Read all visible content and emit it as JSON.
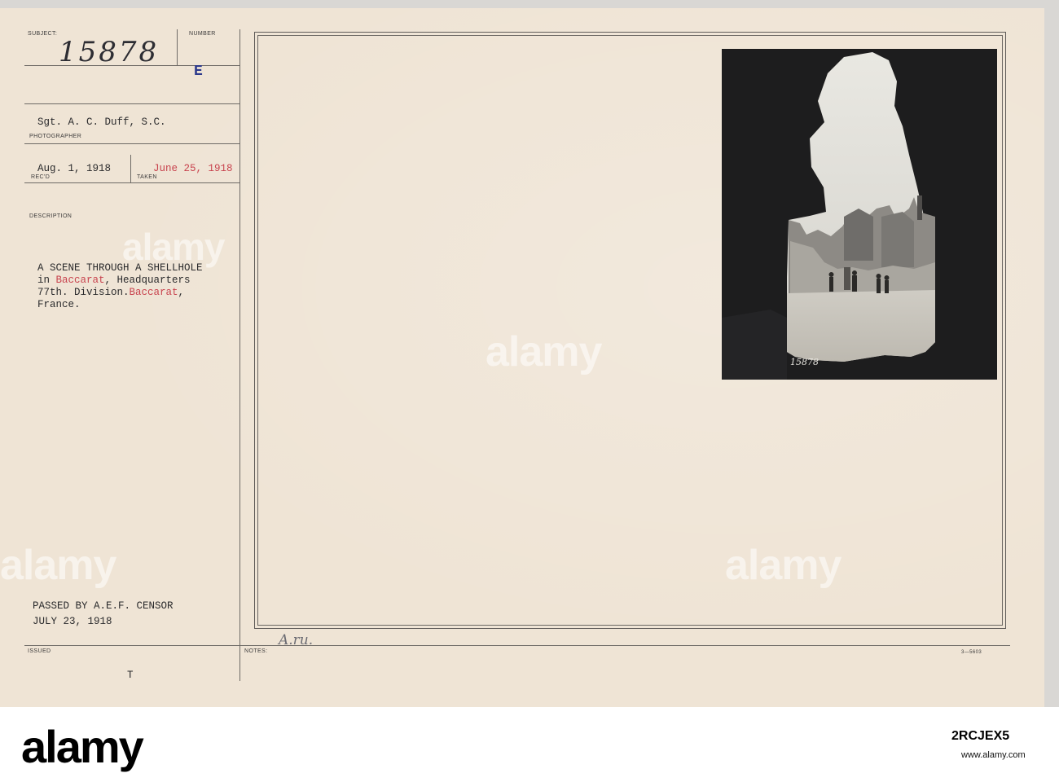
{
  "card": {
    "subject_label": "SUBJECT:",
    "number_label": "NUMBER",
    "subject_number": "15878",
    "number_letter": "E",
    "photographer": "Sgt. A. C. Duff, S.C.",
    "photographer_label": "PHOTOGRAPHER",
    "received": "Aug. 1, 1918",
    "received_label": "REC'D",
    "taken": "June 25, 1918",
    "taken_label": "TAKEN",
    "description_label": "DESCRIPTION",
    "description": {
      "line1": "A SCENE THROUGH A SHELLHOLE",
      "line2_a": "in ",
      "line2_red": "Baccarat",
      "line2_b": ", Headquarters",
      "line3_a": "77th. Division.",
      "line3_red": "Baccarat",
      "line3_b": ",",
      "line4": "France."
    },
    "censor_line1": "PASSED BY A.E.F. CENSOR",
    "censor_line2": "JULY 23, 1918",
    "issued_label": "ISSUED",
    "issued_value": "T",
    "notes_label": "NOTES:",
    "notes_handwriting": "A.ru.",
    "form_number": "3—5603",
    "photo_number": "15878"
  },
  "watermark": {
    "text": "alamy"
  },
  "footer": {
    "logo": "alamy",
    "image_id": "2RCJEX5",
    "site": "www.alamy.com"
  },
  "colors": {
    "card": "#efe4d5",
    "typed_red": "#c8434e",
    "ink": "#2a2a2c"
  }
}
